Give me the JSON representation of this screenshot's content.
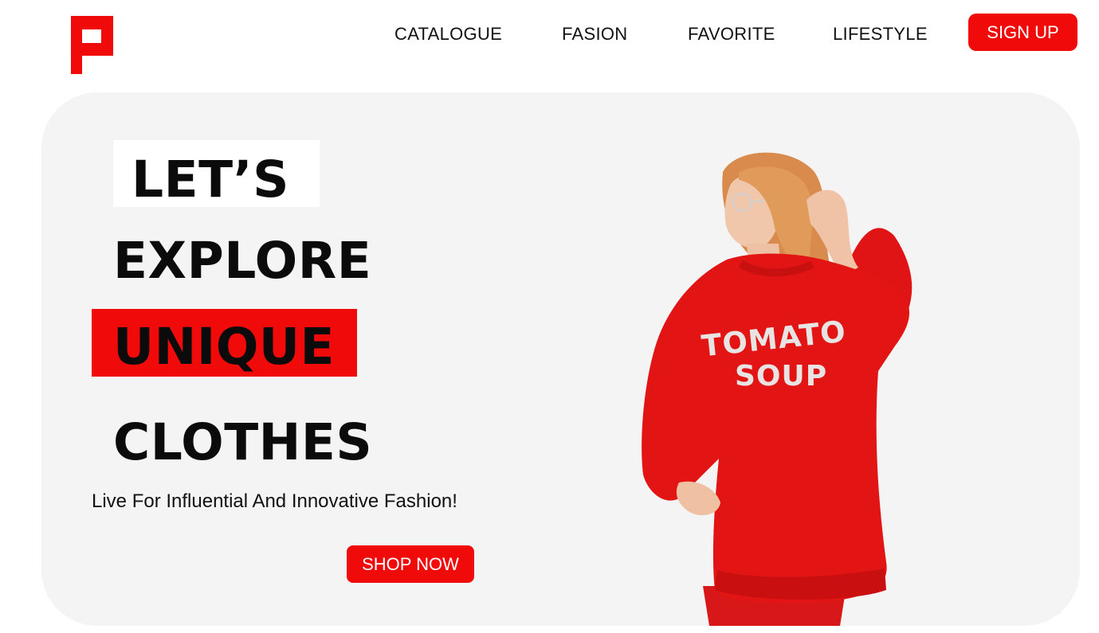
{
  "brand": {
    "logo_icon": "p-logo-icon",
    "accent_color": "#f00a0a"
  },
  "nav": {
    "items": [
      {
        "label": "CATALOGUE"
      },
      {
        "label": "FASION"
      },
      {
        "label": "FAVORITE"
      },
      {
        "label": "LIFESTYLE"
      }
    ],
    "signup_label": "SIGN UP"
  },
  "hero": {
    "headline": [
      "LET’S",
      "EXPLORE",
      "UNIQUE",
      "CLOTHES"
    ],
    "tagline": "Live For Influential And Innovative Fashion!",
    "cta_label": "SHOP NOW",
    "shirt_print": [
      "TOMATO",
      "SOUP"
    ],
    "background_color": "#f4f4f4"
  }
}
